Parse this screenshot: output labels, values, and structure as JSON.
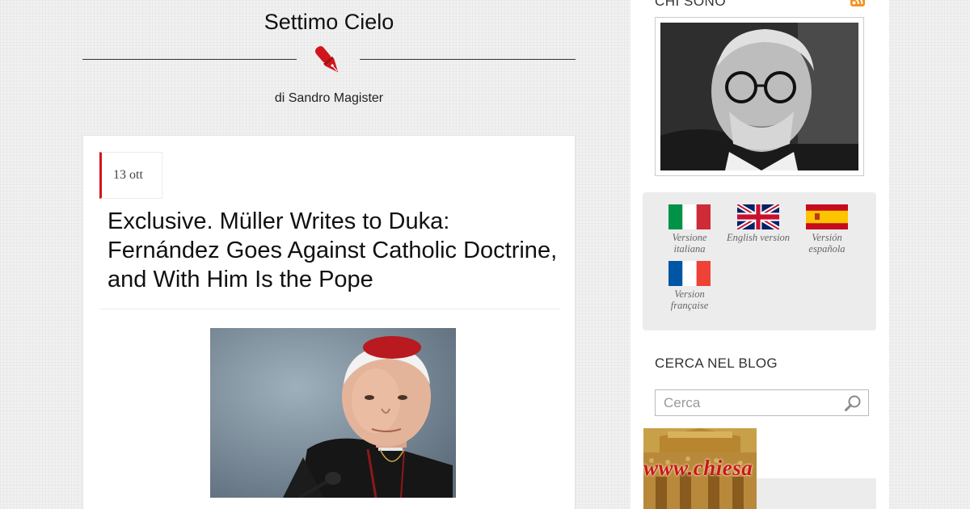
{
  "header": {
    "blog_title": "Settimo Cielo",
    "byline": "di Sandro Magister",
    "logo_icon": "fountain-pen-icon",
    "accent_color": "#d0161d"
  },
  "post": {
    "date": "13 ott",
    "title": "Exclusive. Müller Writes to Duka: Fernández Goes Against Catholic Doctrine, and With Him Is the Pope"
  },
  "sidebar": {
    "about_heading": "CHI SONO",
    "rss_icon": "rss-icon",
    "languages": [
      {
        "label": "Versione italiana",
        "flag": "italy-flag-icon"
      },
      {
        "label": "English version",
        "flag": "uk-flag-icon"
      },
      {
        "label": "Versión española",
        "flag": "spain-flag-icon"
      },
      {
        "label": "Version française",
        "flag": "france-flag-icon"
      }
    ],
    "search": {
      "heading": "CERCA NEL BLOG",
      "placeholder": "Cerca"
    },
    "banner_text": "www.chiesa"
  }
}
